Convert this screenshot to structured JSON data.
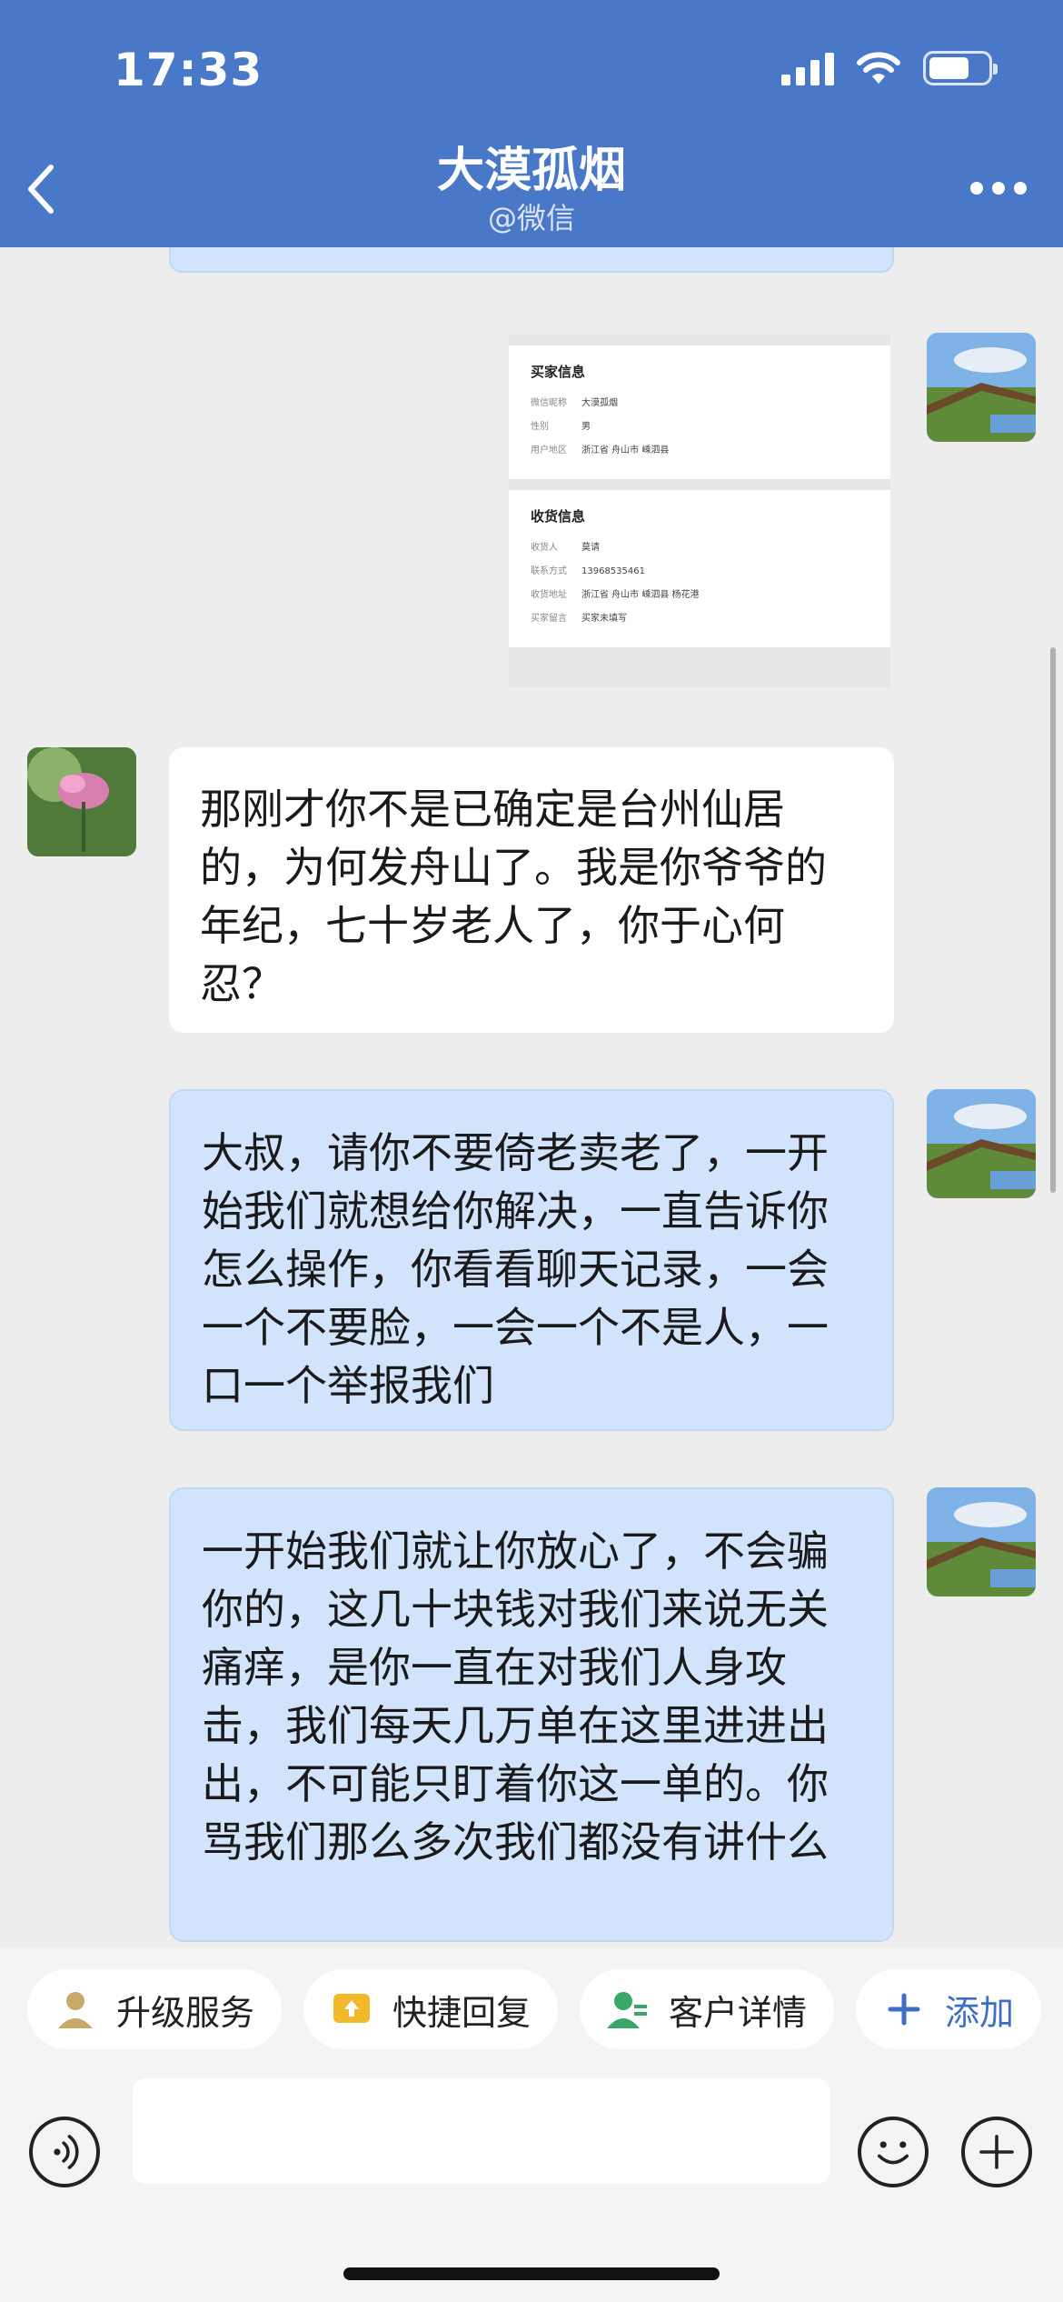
{
  "status_bar": {
    "time": "17:33"
  },
  "header": {
    "title": "大漠孤烟",
    "subtitle": "@微信"
  },
  "order_card": {
    "buyer": {
      "section_title": "买家信息",
      "rows": [
        {
          "k": "微信昵称",
          "v": "大漠孤烟"
        },
        {
          "k": "性别",
          "v": "男"
        },
        {
          "k": "用户地区",
          "v": "浙江省 舟山市 嵊泗县"
        }
      ]
    },
    "delivery": {
      "section_title": "收货信息",
      "rows": [
        {
          "k": "收货人",
          "v": "莫请"
        },
        {
          "k": "联系方式",
          "v": "13968535461"
        },
        {
          "k": "收货地址",
          "v": "浙江省 舟山市 嵊泗县 杨花港"
        },
        {
          "k": "买家留言",
          "v": "买家未填写"
        }
      ]
    }
  },
  "messages": [
    {
      "side": "left",
      "text": "那刚才你不是已确定是台州仙居的，为何发舟山了。我是你爷爷的年纪，七十岁老人了，你于心何忍？"
    },
    {
      "side": "right",
      "text": "大叔，请你不要倚老卖老了，一开始我们就想给你解决，一直告诉你怎么操作，你看看聊天记录，一会一个不要脸，一会一个不是人，一口一个举报我们"
    },
    {
      "side": "right",
      "text": "一开始我们就让你放心了，不会骗你的，这几十块钱对我们来说无关痛痒，是你一直在对我们人身攻击，我们每天几万单在这里进进出出，不可能只盯着你这一单的。你骂我们那么多次我们都没有讲什么"
    }
  ],
  "quick_actions": [
    {
      "label": "升级服务",
      "icon": "person-icon"
    },
    {
      "label": "快捷回复",
      "icon": "upload-message-icon"
    },
    {
      "label": "客户详情",
      "icon": "customer-detail-icon"
    },
    {
      "label": "添加",
      "icon": "plus-icon"
    }
  ],
  "input": {
    "placeholder": ""
  },
  "colors": {
    "header": "#4a78c9",
    "bubble_right": "#d2e4fb",
    "bubble_left": "#ffffff",
    "accent": "#3e6fc6"
  }
}
